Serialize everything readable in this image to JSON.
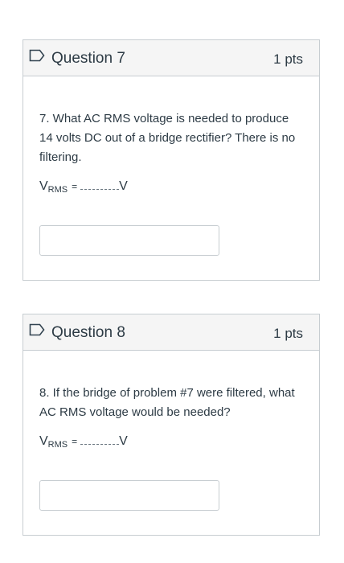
{
  "questions": [
    {
      "title": "Question 7",
      "points": "1 pts",
      "text": "7. What AC RMS voltage is needed to produce 14 volts DC out of a bridge rectifier? There is no filtering.",
      "formula": {
        "var": "V",
        "sub": "RMS",
        "eq": "=",
        "unit": "V"
      },
      "answer": "",
      "flag_icon": "flag-outline-icon"
    },
    {
      "title": "Question 8",
      "points": "1 pts",
      "text": "8. If the bridge of problem #7 were filtered, what AC RMS voltage would be needed?",
      "formula": {
        "var": "V",
        "sub": "RMS",
        "eq": "=",
        "unit": "V"
      },
      "answer": "",
      "flag_icon": "flag-outline-icon"
    }
  ],
  "colors": {
    "header_bg": "#f5f5f5",
    "border": "#c7cdd1",
    "text": "#2d3b45",
    "flag_stroke": "#334451"
  }
}
